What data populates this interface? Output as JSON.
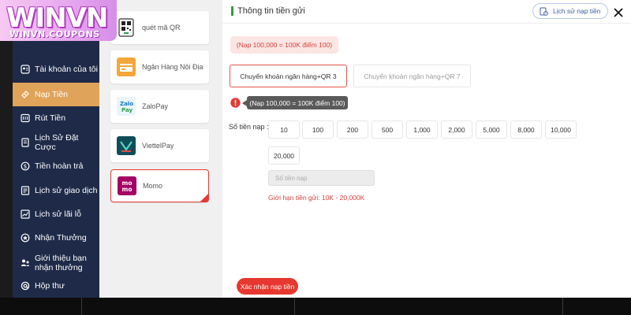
{
  "logo": {
    "text": "WINVN",
    "subtext": "WINVN.COUPONS"
  },
  "sidebar": {
    "items": [
      {
        "label": "Tài khoản của tôi",
        "icon": "account-icon"
      },
      {
        "label": "Nạp Tiền",
        "icon": "deposit-icon",
        "active": true
      },
      {
        "label": "Rút Tiền",
        "icon": "withdraw-icon"
      },
      {
        "label": "Lịch Sử Đặt Cược",
        "icon": "bet-history-icon"
      },
      {
        "label": "Tiền hoàn trả",
        "icon": "refund-icon"
      },
      {
        "label": "Lịch sử giao dịch",
        "icon": "transaction-history-icon"
      },
      {
        "label": "Lịch sử lãi lỗ",
        "icon": "profit-loss-icon"
      },
      {
        "label": "Nhận Thưởng",
        "icon": "reward-icon"
      },
      {
        "label_line1": "Giới thiệu bạn",
        "label_line2": "nhận thưởng",
        "icon": "referral-icon"
      },
      {
        "label": "Hộp thư",
        "icon": "mailbox-icon"
      }
    ]
  },
  "methods": [
    {
      "label": "quét mã QR",
      "icon": "qr-icon"
    },
    {
      "label": "Ngân Hàng Nội Địa",
      "icon": "bank-icon"
    },
    {
      "label": "ZaloPay",
      "icon": "zalopay-icon"
    },
    {
      "label": "ViettelPay",
      "icon": "viettelpay-icon"
    },
    {
      "label": "Momo",
      "icon": "momo-icon",
      "selected": true
    }
  ],
  "main": {
    "title": "Thông tin tiền gửi",
    "history_button": "Lịch sử nạp tiền",
    "rate_note": "(Nạp 100,000 = 100K điểm 100)",
    "bank_options": [
      {
        "label": "Chuyển khoản ngân hàng+QR 3",
        "selected": true
      },
      {
        "label": "Chuyển khoản ngân hàng+QR 7",
        "selected": false
      }
    ],
    "tooltip": "(Nạp 100,000 = 100K điểm 100)",
    "amount_label": "Số tiền nạp :",
    "amounts": [
      "10",
      "100",
      "200",
      "500",
      "1,000",
      "2,000",
      "5,000",
      "8,000",
      "10,000",
      "20,000"
    ],
    "amount_placeholder": "Số tiền nạp",
    "limit_text": "Giới hạn tiền gửi:  10K  - 20,000K",
    "confirm_button": "Xác nhận nạp tiền"
  },
  "colors": {
    "nav_bg": "#1e2a48",
    "nav_active": "#dfa35a",
    "accent_red": "#e6382f",
    "accent_green": "#2e9e3c"
  }
}
